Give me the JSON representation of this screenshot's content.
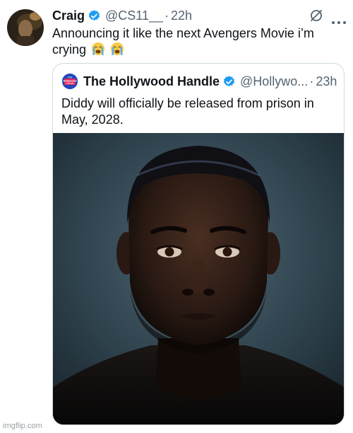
{
  "tweet": {
    "author_name": "Craig",
    "handle": "@CS11__",
    "separator": "·",
    "time": "22h",
    "text": "Announcing it like the next Avengers Movie i’m crying",
    "emojis": [
      "loudly-crying-face",
      "loudly-crying-face"
    ],
    "icons": {
      "verified": "verified-badge-icon",
      "grok": "grok-icon",
      "more": "more-icon"
    },
    "colors": {
      "verified": "#1d9bf0",
      "secondary_text": "#536471",
      "border": "#cfd9de"
    }
  },
  "quote": {
    "author_name": "The Hollywood Handle",
    "handle": "@Hollywo...",
    "separator": "·",
    "time": "23h",
    "text": "Diddy will officially be released from prison in May, 2028.",
    "avatar_logo_lines": [
      "THE",
      "Hollywood",
      "Handle"
    ],
    "image": "portrait-photo"
  },
  "watermark": "imgflip.com"
}
